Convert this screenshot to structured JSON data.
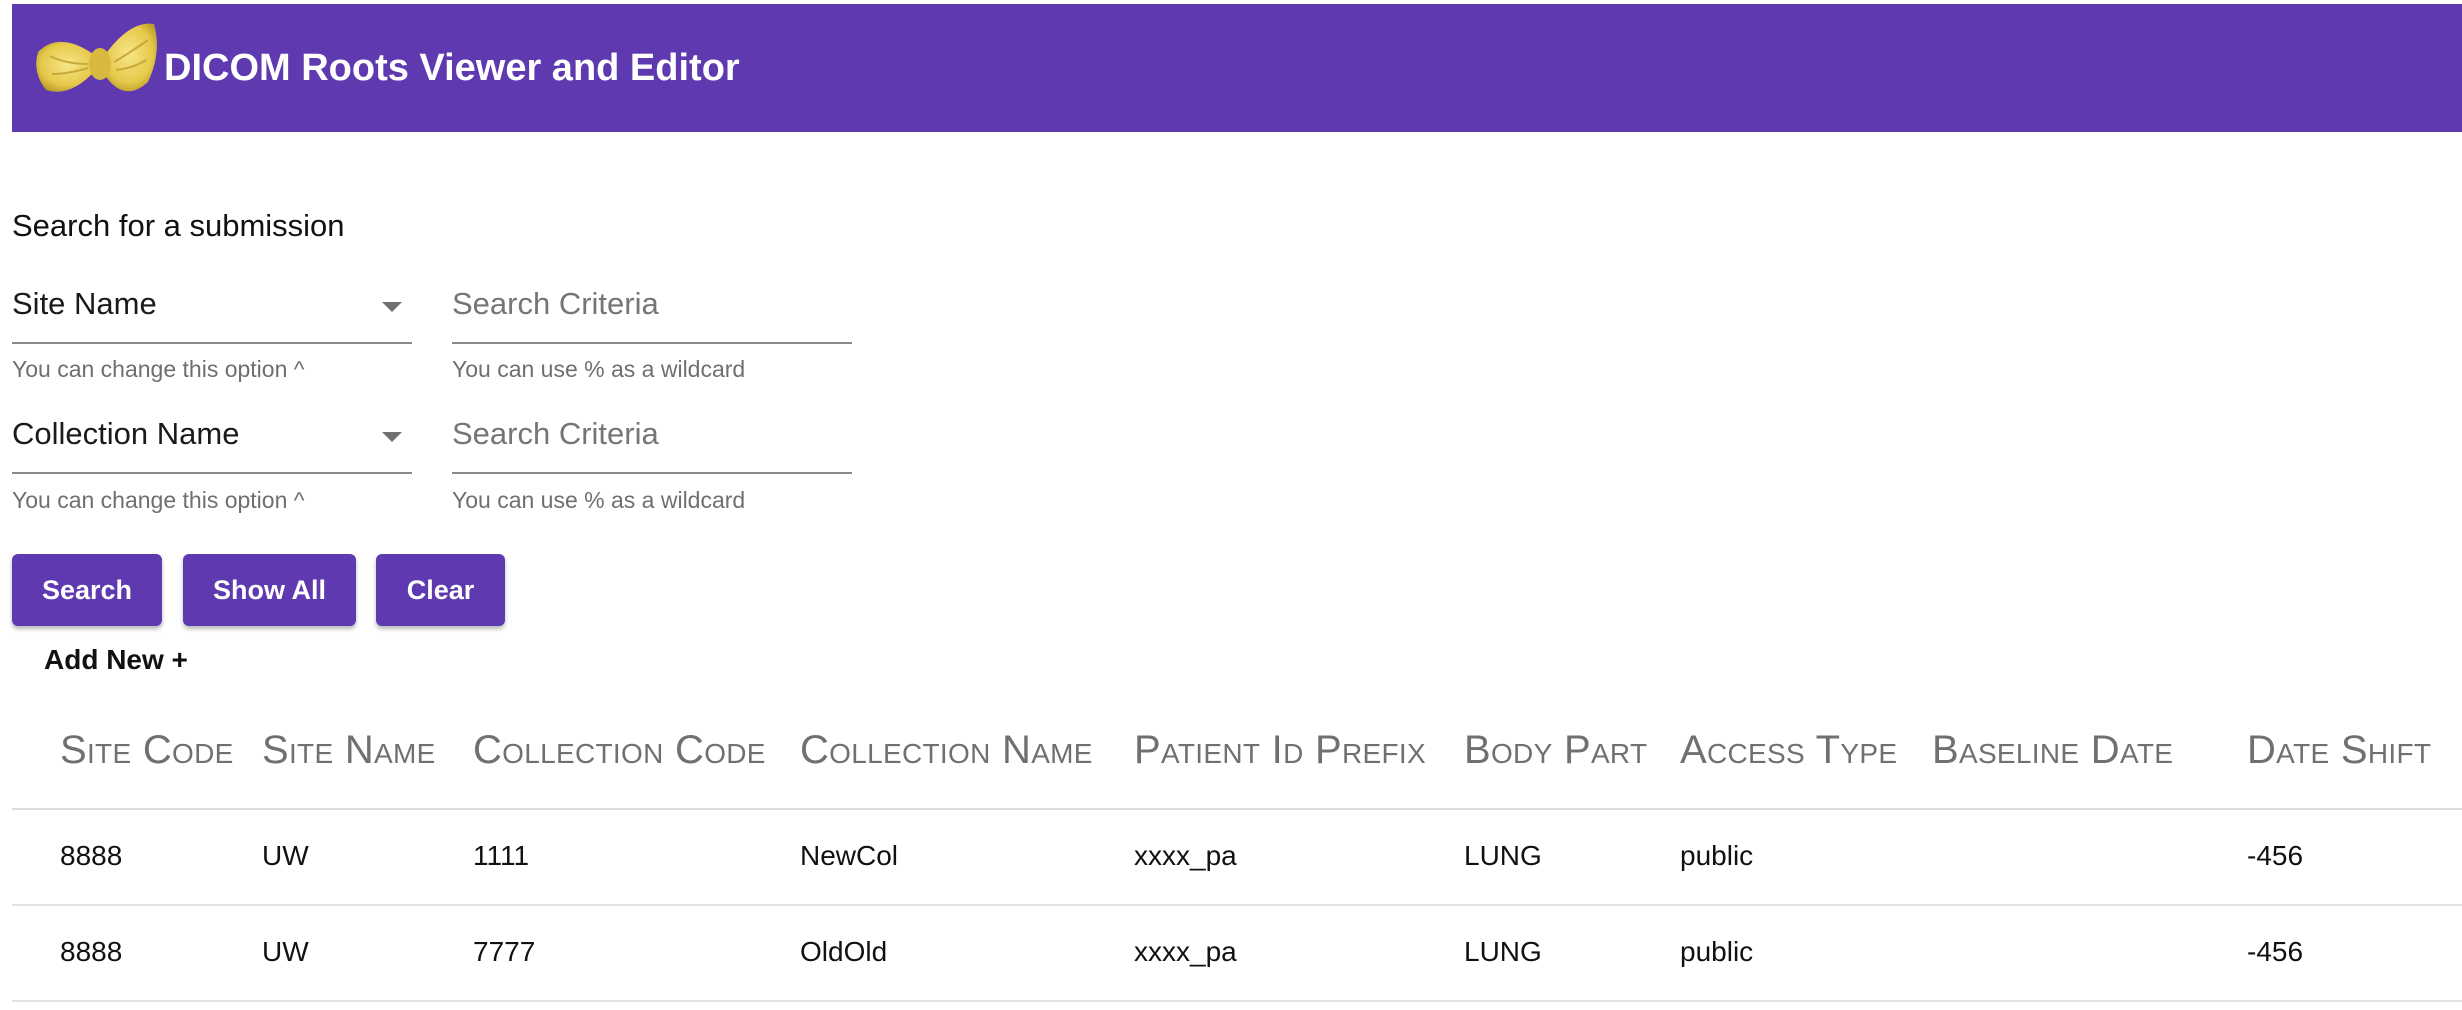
{
  "app": {
    "title": "DICOM Roots Viewer and Editor",
    "accent_color": "#5e39b0",
    "logo_icon": "bowtie-pasta-logo"
  },
  "search": {
    "heading": "Search for a submission",
    "fields": [
      {
        "select_value": "Site Name",
        "select_hint": "You can change this option ^",
        "criteria_placeholder": "Search Criteria",
        "criteria_hint": "You can use % as a wildcard"
      },
      {
        "select_value": "Collection Name",
        "select_hint": "You can change this option ^",
        "criteria_placeholder": "Search Criteria",
        "criteria_hint": "You can use % as a wildcard"
      }
    ],
    "buttons": {
      "search": "Search",
      "show_all": "Show All",
      "clear": "Clear"
    },
    "add_new": "Add New +"
  },
  "table": {
    "columns": [
      "Site Code",
      "Site Name",
      "Collection Code",
      "Collection Name",
      "Patient Id Prefix",
      "Body Part",
      "Access Type",
      "Baseline Date",
      "Date Shift"
    ],
    "rows": [
      [
        "8888",
        "UW",
        "1111",
        "NewCol",
        "xxxx_pa",
        "LUNG",
        "public",
        "",
        "-456"
      ],
      [
        "8888",
        "UW",
        "7777",
        "OldOld",
        "xxxx_pa",
        "LUNG",
        "public",
        "",
        "-456"
      ]
    ]
  }
}
